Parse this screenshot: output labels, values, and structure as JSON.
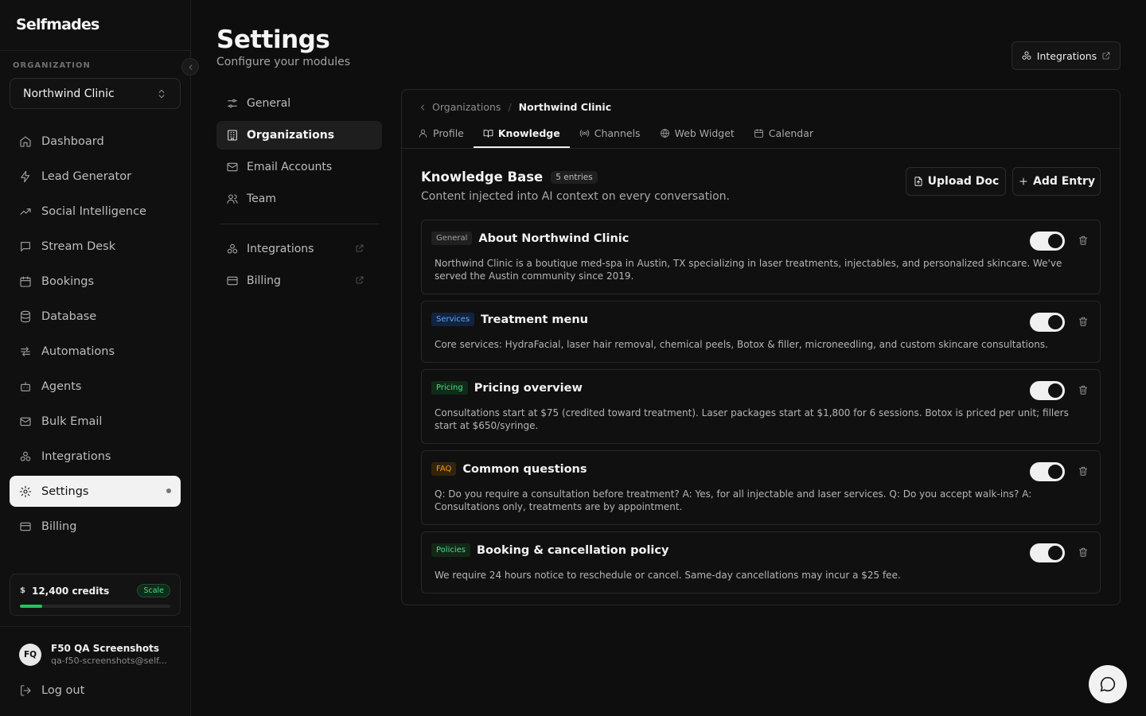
{
  "app": {
    "logo": "Selfmades"
  },
  "sidebar": {
    "org_label": "ORGANIZATION",
    "org_selected": "Northwind Clinic",
    "items": [
      {
        "label": "Dashboard",
        "icon": "home-icon"
      },
      {
        "label": "Lead Generator",
        "icon": "bolt-icon"
      },
      {
        "label": "Social Intelligence",
        "icon": "trend-icon"
      },
      {
        "label": "Stream Desk",
        "icon": "message-icon"
      },
      {
        "label": "Bookings",
        "icon": "calendar-icon"
      },
      {
        "label": "Database",
        "icon": "database-icon"
      },
      {
        "label": "Automations",
        "icon": "workflow-icon"
      },
      {
        "label": "Agents",
        "icon": "bot-icon"
      },
      {
        "label": "Bulk Email",
        "icon": "mail-icon"
      },
      {
        "label": "Integrations",
        "icon": "integrations-icon"
      },
      {
        "label": "Settings",
        "icon": "gear-icon",
        "active": true
      },
      {
        "label": "Billing",
        "icon": "card-icon"
      }
    ],
    "credits": {
      "symbol": "$",
      "text": "12,400 credits",
      "plan": "Scale",
      "progress": 0.15
    },
    "user": {
      "initials": "FQ",
      "name": "F50 QA Screenshots",
      "email": "qa-f50-screenshots@self..."
    },
    "logout": "Log out"
  },
  "header": {
    "title": "Settings",
    "subtitle": "Configure your modules",
    "integrations_button": "Integrations"
  },
  "subnav": {
    "items": [
      {
        "label": "General"
      },
      {
        "label": "Organizations",
        "active": true
      },
      {
        "label": "Email Accounts"
      },
      {
        "label": "Team"
      }
    ],
    "external": [
      {
        "label": "Integrations"
      },
      {
        "label": "Billing"
      }
    ]
  },
  "panel": {
    "breadcrumb": {
      "parent": "Organizations",
      "sep": "/",
      "current": "Northwind Clinic"
    },
    "tabs": [
      {
        "label": "Profile"
      },
      {
        "label": "Knowledge",
        "active": true
      },
      {
        "label": "Channels"
      },
      {
        "label": "Web Widget"
      },
      {
        "label": "Calendar"
      }
    ],
    "kb": {
      "title": "Knowledge Base",
      "count": "5 entries",
      "description": "Content injected into AI context on every conversation.",
      "upload_label": "Upload Doc",
      "add_label": "Add Entry"
    },
    "entries": [
      {
        "tag": "General",
        "tag_color": "#a3a3a3",
        "title": "About Northwind Clinic",
        "text": "Northwind Clinic is a boutique med-spa in Austin, TX specializing in laser treatments, injectables, and personalized skincare. We've served the Austin community since 2019.",
        "enabled": true
      },
      {
        "tag": "Services",
        "tag_color": "#60a5fa",
        "title": "Treatment menu",
        "text": "Core services: HydraFacial, laser hair removal, chemical peels, Botox & filler, microneedling, and custom skincare consultations.",
        "enabled": true
      },
      {
        "tag": "Pricing",
        "tag_color": "#4ade80",
        "title": "Pricing overview",
        "text": "Consultations start at $75 (credited toward treatment). Laser packages start at $1,800 for 6 sessions. Botox is priced per unit; fillers start at $650/syringe.",
        "enabled": true
      },
      {
        "tag": "FAQ",
        "tag_color": "#f59e0b",
        "title": "Common questions",
        "text": "Q: Do you require a consultation before treatment? A: Yes, for all injectable and laser services. Q: Do you accept walk-ins? A: Consultations only, treatments are by appointment.",
        "enabled": true
      },
      {
        "tag": "Policies",
        "tag_color": "#4ade80",
        "title": "Booking & cancellation policy",
        "text": "We require 24 hours notice to reschedule or cancel. Same-day cancellations may incur a $25 fee.",
        "enabled": true
      }
    ]
  },
  "colors": {
    "accent": "#f2f2f2",
    "background": "#0e0e0e",
    "success": "#22c55e"
  }
}
